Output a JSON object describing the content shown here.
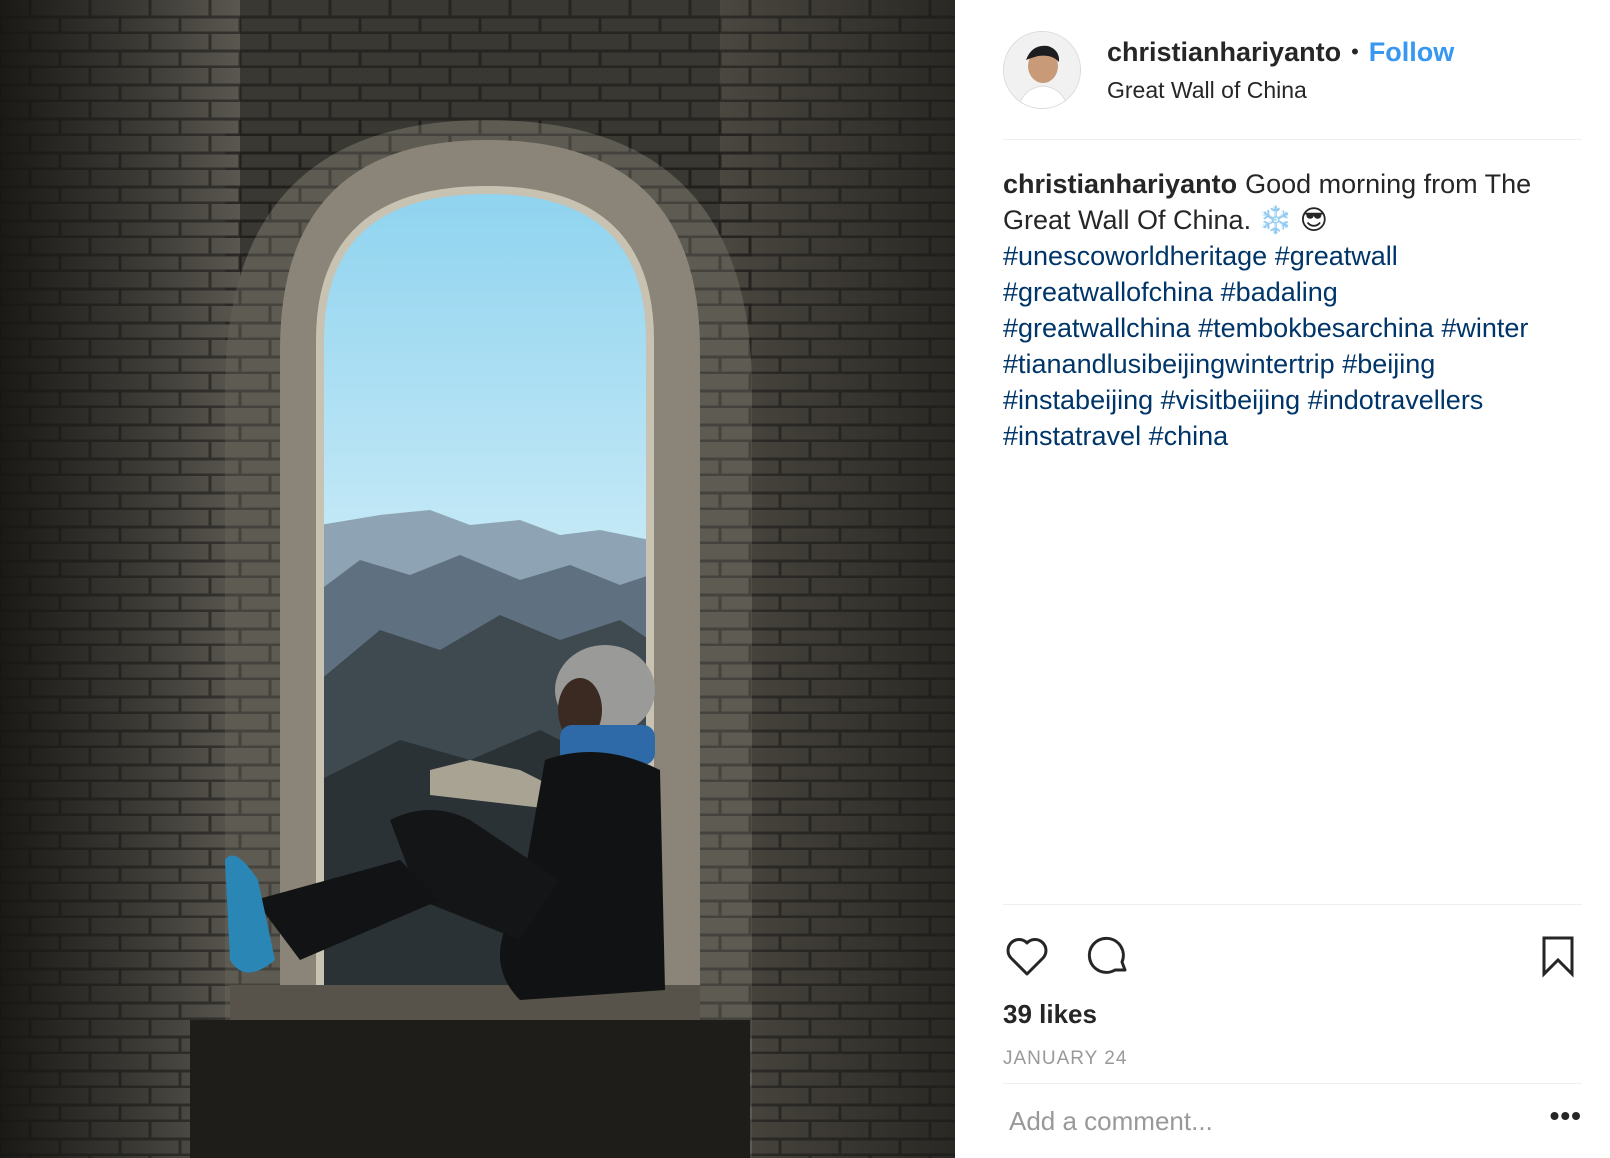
{
  "post": {
    "username": "christianhariyanto",
    "separator": "•",
    "follow_label": "Follow",
    "location": "Great Wall of China",
    "caption": {
      "username": "christianhariyanto",
      "text": "Good morning from The Great Wall Of China.",
      "emoji_1": "❄️",
      "emoji_2": "😎",
      "hashtags": [
        "#unescoworldheritage",
        "#greatwall",
        "#greatwallofchina",
        "#badaling",
        "#greatwallchina",
        "#tembokbesarchina",
        "#winter",
        "#tianandlusibeijingwintertrip",
        "#beijing",
        "#instabeijing",
        "#visitbeijing",
        "#indotravellers",
        "#instatravel",
        "#china"
      ]
    },
    "likes": "39 likes",
    "date": "JANUARY 24",
    "comment_placeholder": "Add a comment...",
    "more_label": "•••"
  },
  "icons": {
    "like": "heart-icon",
    "comment": "speech-bubble-icon",
    "save": "bookmark-icon"
  },
  "colors": {
    "link": "#3897f0",
    "hashtag": "#003569",
    "muted": "#999999",
    "text": "#262626"
  }
}
